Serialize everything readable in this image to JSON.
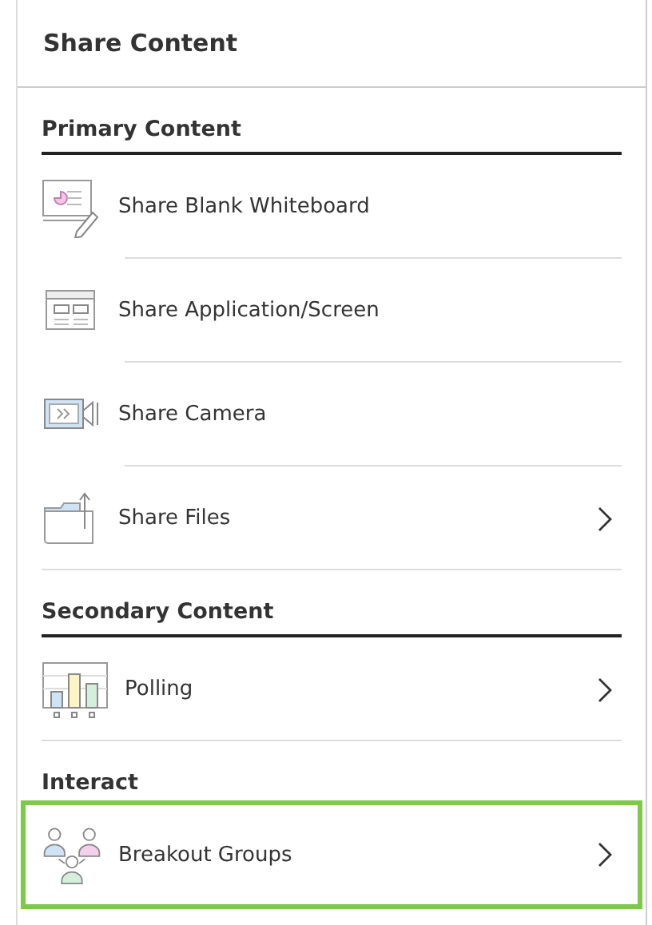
{
  "panel": {
    "title": "Share Content"
  },
  "sections": [
    {
      "title": "Primary Content",
      "underline": true,
      "items": [
        {
          "label": "Share Blank Whiteboard",
          "kind": "whiteboard",
          "submenu": false,
          "selected": false
        },
        {
          "label": "Share Application/Screen",
          "kind": "screen",
          "submenu": false,
          "selected": false
        },
        {
          "label": "Share Camera",
          "kind": "camera",
          "submenu": false,
          "selected": false
        },
        {
          "label": "Share Files",
          "kind": "files",
          "submenu": true,
          "selected": false
        }
      ]
    },
    {
      "title": "Secondary Content",
      "underline": true,
      "items": [
        {
          "label": "Polling",
          "kind": "polling",
          "submenu": true,
          "selected": false
        }
      ]
    },
    {
      "title": "Interact",
      "underline": false,
      "items": [
        {
          "label": "Breakout Groups",
          "kind": "groups",
          "submenu": true,
          "selected": true
        }
      ]
    }
  ]
}
